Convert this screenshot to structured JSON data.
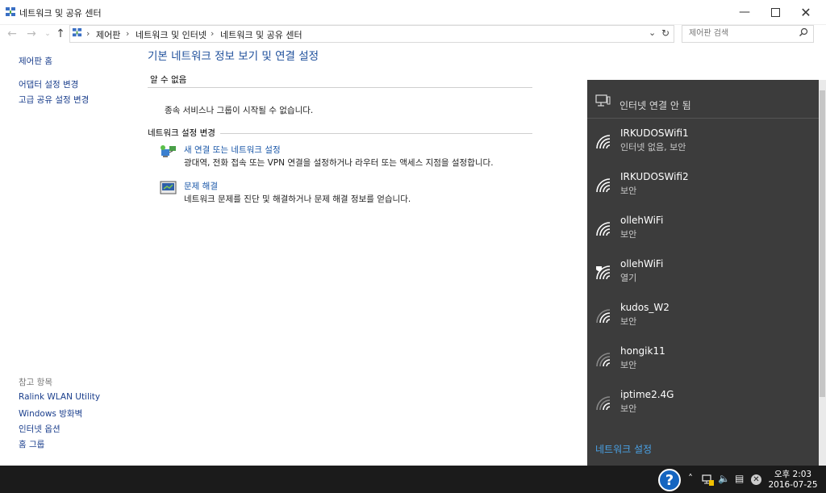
{
  "window": {
    "title": "네트워크 및 공유 센터",
    "minimize_icon": "minimize-icon",
    "maximize_icon": "maximize-icon",
    "close_icon": "close-icon"
  },
  "address": {
    "crumbs": [
      "제어판",
      "네트워크 및 인터넷",
      "네트워크 및 공유 센터"
    ],
    "search_placeholder": "제어판 검색"
  },
  "left_nav": {
    "home": "제어판 홈",
    "links": [
      "어댑터 설정 변경",
      "고급 공유 설정 변경"
    ],
    "see_also_heading": "참고 항목",
    "see_also": [
      "Ralink WLAN Utility",
      "Windows 방화벽",
      "인터넷 옵션",
      "홈 그룹"
    ]
  },
  "main": {
    "title": "기본 네트워크 정보 보기 및 연결 설정",
    "unknown_heading": "알 수 없음",
    "unknown_message": "종속 서비스나 그룹이 시작될 수 없습니다.",
    "change_heading": "네트워크 설정 변경",
    "tasks": [
      {
        "link": "새 연결 또는 네트워크 설정",
        "desc": "광대역, 전화 접속 또는 VPN 연결을 설정하거나 라우터 또는 액세스 지점을 설정합니다."
      },
      {
        "link": "문제 해결",
        "desc": "네트워크 문제를 진단 및 해결하거나 문제 해결 정보를 얻습니다."
      }
    ]
  },
  "flyout": {
    "status": "인터넷 연결 안 됨",
    "networks": [
      {
        "name": "IRKUDOSWifi1",
        "status": "인터넷 없음, 보안"
      },
      {
        "name": "IRKUDOSWifi2",
        "status": "보안"
      },
      {
        "name": "ollehWiFi",
        "status": "보안"
      },
      {
        "name": "ollehWiFi",
        "status": "열기"
      },
      {
        "name": "kudos_W2",
        "status": "보안"
      },
      {
        "name": "hongik11",
        "status": "보안"
      },
      {
        "name": "iptime2.4G",
        "status": "보안"
      }
    ],
    "settings_link": "네트워크 설정"
  },
  "taskbar": {
    "time": "오후 2:03",
    "date": "2016-07-25"
  },
  "colors": {
    "link": "#1a57a8",
    "title": "#1e4f9b",
    "flyout_bg": "#3c3c3c",
    "flyout_link": "#4aa3e8",
    "taskbar_bg": "#1b1b1b"
  }
}
